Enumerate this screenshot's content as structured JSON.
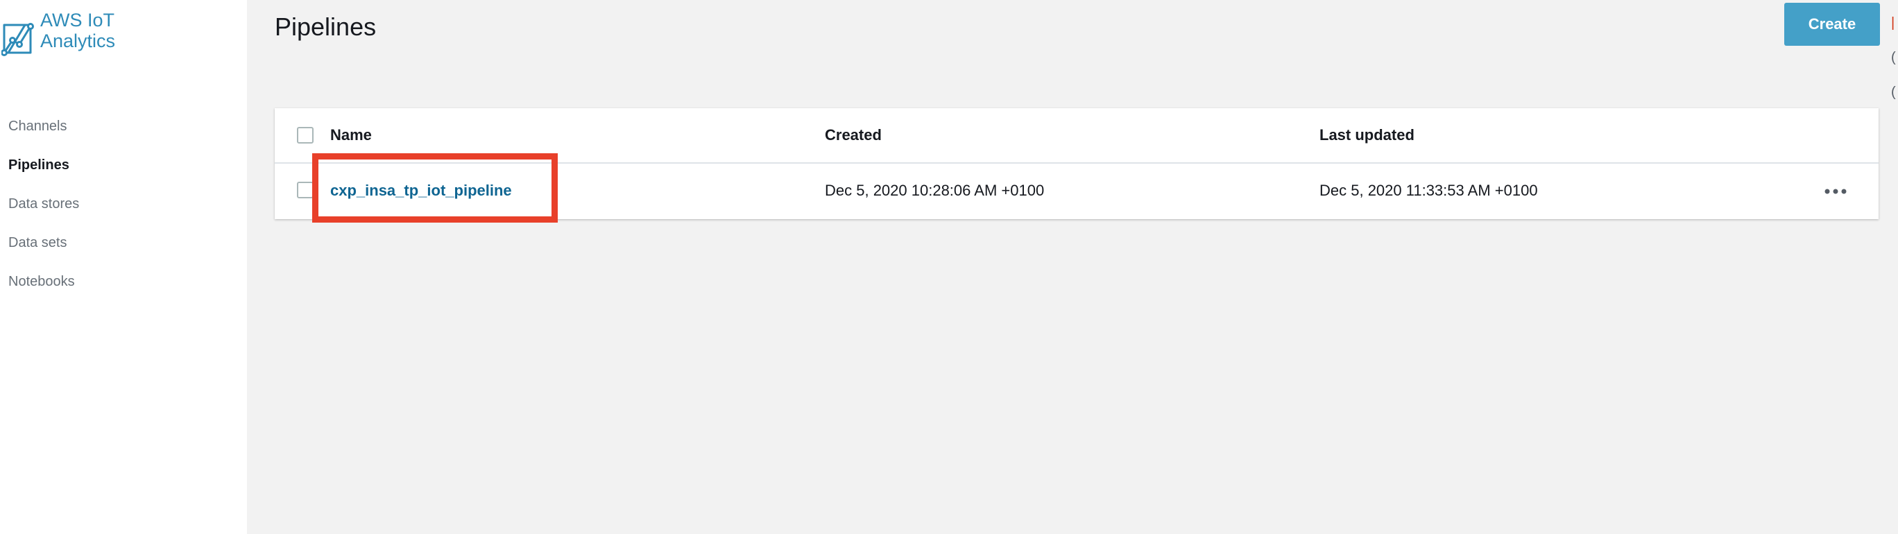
{
  "app": {
    "brand_line1": "AWS IoT",
    "brand_line2": "Analytics",
    "brand_color": "#2e8bb8",
    "logo_icon": "iot-analytics-logo-icon"
  },
  "sidebar": {
    "items": [
      {
        "label": "Channels",
        "active": false
      },
      {
        "label": "Pipelines",
        "active": true
      },
      {
        "label": "Data stores",
        "active": false
      },
      {
        "label": "Data sets",
        "active": false
      },
      {
        "label": "Notebooks",
        "active": false
      }
    ]
  },
  "page": {
    "title": "Pipelines",
    "create_label": "Create",
    "accent_color": "#44a0c8"
  },
  "table": {
    "columns": [
      "Name",
      "Created",
      "Last updated"
    ],
    "rows": [
      {
        "name": "cxp_insa_tp_iot_pipeline",
        "created": "Dec 5, 2020 10:28:06 AM +0100",
        "last_updated": "Dec 5, 2020 11:33:53 AM +0100",
        "actions_icon": "more-options-icon",
        "highlighted": true
      }
    ]
  },
  "annotation": {
    "highlight_color": "#e8402a"
  }
}
